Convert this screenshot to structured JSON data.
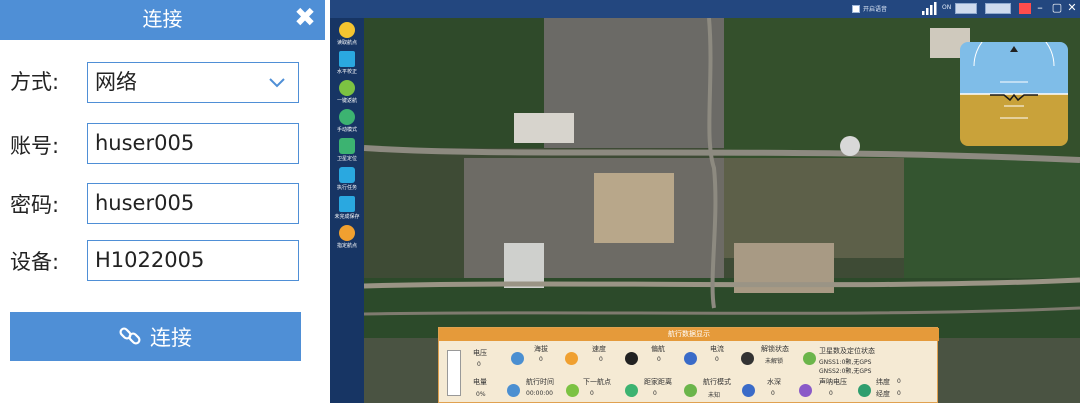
{
  "dialog": {
    "title": "连接",
    "fields": {
      "mode": {
        "label": "方式:",
        "value": "网络"
      },
      "account": {
        "label": "账号:",
        "value": "huser005"
      },
      "password": {
        "label": "密码:",
        "value": "huser005"
      },
      "device": {
        "label": "设备:",
        "value": "H1022005"
      }
    },
    "connect_label": "连接"
  },
  "topbar": {
    "checkbox_label": "开启语音",
    "signal_label": "ON"
  },
  "sidebar": {
    "items": [
      {
        "label": "读取航点",
        "icon": "search-icon",
        "color": "#f4c430"
      },
      {
        "label": "水平校正",
        "icon": "level-icon",
        "color": "#2aa8e0"
      },
      {
        "label": "一键返航",
        "icon": "return-icon",
        "color": "#7cc242"
      },
      {
        "label": "手动模式",
        "icon": "manual-icon",
        "color": "#3cb371"
      },
      {
        "label": "卫星定位",
        "icon": "location-icon",
        "color": "#3cb371"
      },
      {
        "label": "执行任务",
        "icon": "task-icon",
        "color": "#2aa8e0"
      },
      {
        "label": "未完成保存",
        "icon": "save-icon",
        "color": "#2aa8e0"
      },
      {
        "label": "指定航点",
        "icon": "waypoint-icon",
        "color": "#f0a030"
      }
    ]
  },
  "telemetry": {
    "title": "航行数据显示",
    "battery": {
      "voltage_label": "电压",
      "voltage_value": "0",
      "capacity_label": "电量",
      "capacity_value": "0%"
    },
    "items": {
      "altitude": {
        "label": "海拔",
        "value": "0"
      },
      "speed": {
        "label": "速度",
        "value": "0"
      },
      "heading": {
        "label": "偏航",
        "value": "0"
      },
      "current": {
        "label": "电流",
        "value": "0"
      },
      "unlock": {
        "label": "解锁状态",
        "value": "未解锁"
      },
      "satellite": {
        "label": "卫星数及定位状态",
        "value1": "GNSS1:0颗,无GPS",
        "value2": "GNSS2:0颗,无GPS"
      },
      "nav_time": {
        "label": "航行时间",
        "value": "00:00:00"
      },
      "next_point": {
        "label": "下一航点",
        "value": "0"
      },
      "home_dist": {
        "label": "距家距离",
        "value": "0"
      },
      "mode": {
        "label": "航行模式",
        "value": "未知"
      },
      "depth": {
        "label": "水深",
        "value": "0"
      },
      "sonar_voltage": {
        "label": "声呐电压",
        "value": "0"
      },
      "latitude": {
        "label": "纬度",
        "value": "0"
      },
      "longitude": {
        "label": "经度",
        "value": "0"
      }
    }
  },
  "colors": {
    "dialog_accent": "#4f8fd6",
    "app_frame": "#1c3d73",
    "telemetry_header": "#e59a3a",
    "attitude_sky": "#7fbde8",
    "attitude_ground": "#c9a23a"
  }
}
